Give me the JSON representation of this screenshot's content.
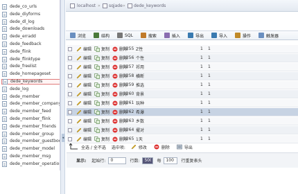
{
  "sidebar": {
    "items": [
      {
        "label": "dede_co_urls"
      },
      {
        "label": "dede_diyforms"
      },
      {
        "label": "dede_dl_log"
      },
      {
        "label": "dede_downloads"
      },
      {
        "label": "dede_erradd"
      },
      {
        "label": "dede_feedback"
      },
      {
        "label": "dede_flink"
      },
      {
        "label": "dede_flinktype"
      },
      {
        "label": "dede_freelist"
      },
      {
        "label": "dede_homepageset"
      },
      {
        "label": "dede_keywords"
      },
      {
        "label": "dede_log"
      },
      {
        "label": "dede_member"
      },
      {
        "label": "dede_member_company"
      },
      {
        "label": "dede_member_feed"
      },
      {
        "label": "dede_member_flink"
      },
      {
        "label": "dede_member_friends"
      },
      {
        "label": "dede_member_group"
      },
      {
        "label": "dede_member_guestbook"
      },
      {
        "label": "dede_member_model"
      },
      {
        "label": "dede_member_msg"
      },
      {
        "label": "dede_member_operation"
      }
    ],
    "active_index": 10
  },
  "topbar": {
    "crumbs": [
      "localhost",
      "sqjade",
      "dede_keywords"
    ]
  },
  "tabs": [
    {
      "label": "浏览",
      "icon": "browse-icon"
    },
    {
      "label": "结构",
      "icon": "structure-icon"
    },
    {
      "label": "SQL",
      "icon": "sql-icon"
    },
    {
      "label": "搜索",
      "icon": "search-icon"
    },
    {
      "label": "插入",
      "icon": "insert-icon"
    },
    {
      "label": "导出",
      "icon": "export-icon"
    },
    {
      "label": "导入",
      "icon": "import-icon"
    },
    {
      "label": "操作",
      "icon": "operations-icon"
    },
    {
      "label": "触发器",
      "icon": "triggers-icon"
    }
  ],
  "row_actions": {
    "edit": "编辑",
    "copy": "复制",
    "delete": "删除"
  },
  "rows": [
    {
      "id": "1255",
      "keyword": "Z性",
      "c1": "1",
      "c2": "1"
    },
    {
      "id": "1256",
      "keyword": "个性",
      "c1": "1",
      "c2": "1"
    },
    {
      "id": "1257",
      "keyword": "祁用",
      "c1": "1",
      "c2": "1"
    },
    {
      "id": "1258",
      "keyword": "横断",
      "c1": "1",
      "c2": "1"
    },
    {
      "id": "1259",
      "keyword": "推选",
      "c1": "1",
      "c2": "1"
    },
    {
      "id": "1260",
      "keyword": "背景",
      "c1": "1",
      "c2": "1"
    },
    {
      "id": "1261",
      "keyword": "玩种",
      "c1": "1",
      "c2": "1"
    },
    {
      "id": "1262",
      "keyword": "希瀑",
      "c1": "1",
      "c2": "1"
    },
    {
      "id": "1263",
      "keyword": "乡数",
      "c1": "1",
      "c2": "1"
    },
    {
      "id": "1264",
      "keyword": "擢对",
      "c1": "1",
      "c2": "1"
    },
    {
      "id": "1265",
      "keyword": "1天",
      "c1": "1",
      "c2": "1"
    }
  ],
  "highlight_row": 7,
  "footer": {
    "select_all": "全选 / 全不选",
    "selected_label": "选中项:",
    "edit": "修改",
    "delete": "删除",
    "export": "导出"
  },
  "pager": {
    "show_label": "显示:",
    "start_label": "起始行:",
    "start_value": "0",
    "rows_label": "行数:",
    "rows_value": "500",
    "per_label": "每",
    "per_value": "100",
    "repeat_label": "行重复表头"
  },
  "colors": {
    "active_border": "#e07a7a",
    "highlight_row": "#c7d3e3",
    "delete_red": "#d33"
  }
}
